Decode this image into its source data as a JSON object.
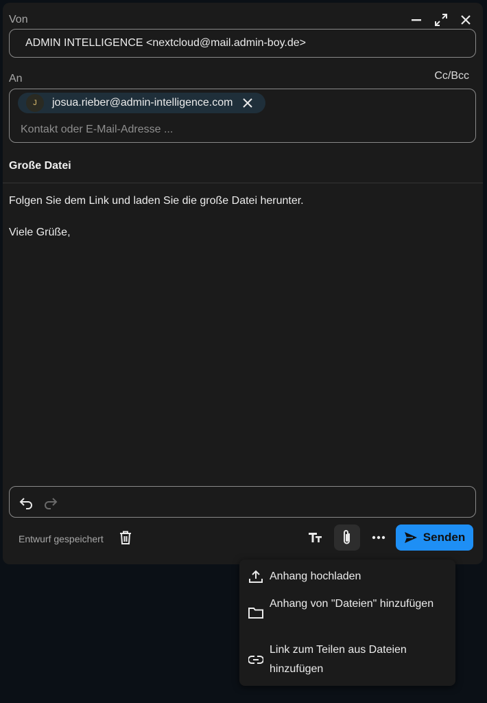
{
  "from": {
    "label": "Von",
    "value": "ADMIN INTELLIGENCE <nextcloud@mail.admin-boy.de>"
  },
  "window_controls": [
    "minimize-icon",
    "expand-icon",
    "close-icon"
  ],
  "to": {
    "label": "An",
    "cc_bcc": "Cc/Bcc",
    "recipients": [
      {
        "initial": "J",
        "address": "josua.rieber@admin-intelligence.com"
      }
    ],
    "placeholder": "Kontakt oder E-Mail-Adresse ..."
  },
  "subject": "Große Datei",
  "body": {
    "line1": "Folgen Sie dem Link und laden Sie die große Datei herunter.",
    "line2": "Viele Grüße,"
  },
  "editor_toolbar": [
    "undo-icon",
    "redo-icon"
  ],
  "footer": {
    "draft_status": "Entwurf gespeichert",
    "send_label": "Senden"
  },
  "attachment_menu": {
    "items": [
      {
        "icon": "upload-icon",
        "label": "Anhang hochladen"
      },
      {
        "icon": "folder-icon",
        "label": "Anhang von \"Dateien\" hinzufügen"
      },
      {
        "icon": "link-icon",
        "label": "Link zum Teilen aus Dateien hinzufügen"
      }
    ]
  },
  "colors": {
    "background": "#0b1016",
    "panel": "#1b1b1b",
    "accent": "#1e8ff5",
    "chip": "#1f2f3a"
  }
}
